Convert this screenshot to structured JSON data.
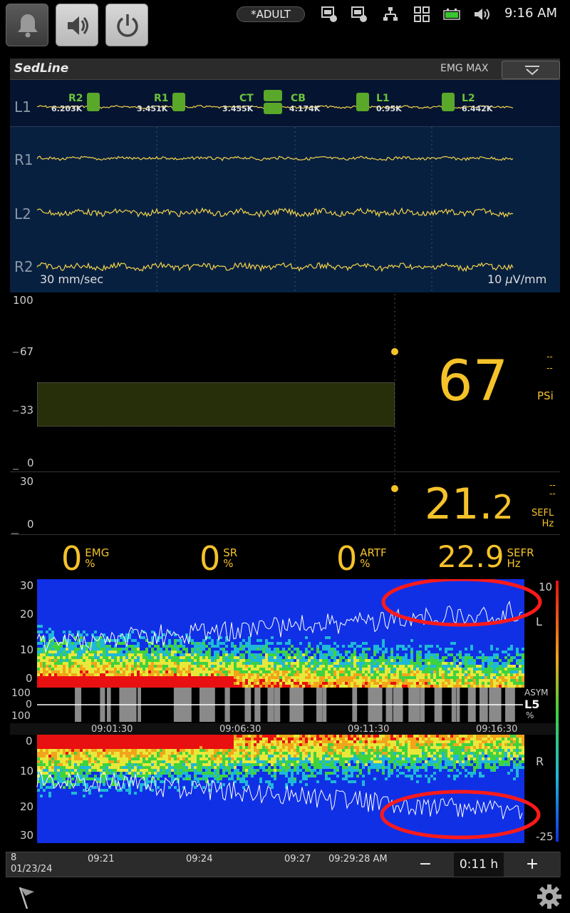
{
  "status_bar": {
    "mode": "*ADULT",
    "time": "9:16 AM",
    "icons": [
      "bell-icon",
      "speaker-icon",
      "power-icon",
      "network-1-icon",
      "network-2-icon",
      "lan-icon",
      "grid-icon",
      "battery-icon",
      "volume-icon"
    ]
  },
  "header": {
    "brand": "SedLine",
    "mode_label": "EMG MAX"
  },
  "eeg": {
    "channels": [
      "L1",
      "R1",
      "L2",
      "R2"
    ],
    "impedances": [
      {
        "name": "R2",
        "value": "6.203K"
      },
      {
        "name": "R1",
        "value": "3.451K"
      },
      {
        "name": "CT",
        "value": "3.455K"
      },
      {
        "name": "CB",
        "value": "4.174K"
      },
      {
        "name": "L1",
        "value": "0.95K"
      },
      {
        "name": "L2",
        "value": "6.442K"
      }
    ],
    "speed": "30 mm/sec",
    "gain_prefix": "10 ",
    "gain_mu": "µ",
    "gain_suffix": "V/mm"
  },
  "psi": {
    "axis": [
      "100",
      "67",
      "33",
      "0"
    ],
    "value": "67",
    "unit": "PSi",
    "limit_hi": "--",
    "limit_lo": "--",
    "band": [
      25,
      50
    ]
  },
  "sef": {
    "axis": [
      "30",
      "0"
    ],
    "value_int": "21.",
    "value_dec": "2",
    "unit_1": "SEFL",
    "unit_2": "Hz",
    "limit_hi": "--",
    "limit_lo": "--"
  },
  "parameters": [
    {
      "value": "0",
      "label": "EMG",
      "unit": "%"
    },
    {
      "value": "0",
      "label": "SR",
      "unit": "%"
    },
    {
      "value": "0",
      "label": "ARTF",
      "unit": "%"
    },
    {
      "value": "22.9",
      "label": "SEFR",
      "unit": "Hz"
    }
  ],
  "dsa": {
    "left_axis": [
      "30",
      "20",
      "10",
      "0"
    ],
    "asym_axis": [
      "100",
      "0",
      "100"
    ],
    "right_axis": [
      "0",
      "10",
      "20",
      "30"
    ],
    "times": [
      "09:01:30",
      "09:06:30",
      "09:11:30",
      "09:16:30"
    ],
    "scale_top": "10",
    "scale_bottom": "-25",
    "left_label": "L",
    "right_label": "R",
    "asym_label": "ASYM",
    "asym_ch": "L5",
    "asym_unit": "%"
  },
  "timeline": {
    "date_top": "8",
    "date": "01/23/24",
    "ticks": [
      "09:21",
      "09:24",
      "09:27"
    ],
    "cursor": "09:29:28 AM",
    "zoom_out": "−",
    "zoom": "0:11 h",
    "zoom_in": "+"
  }
}
